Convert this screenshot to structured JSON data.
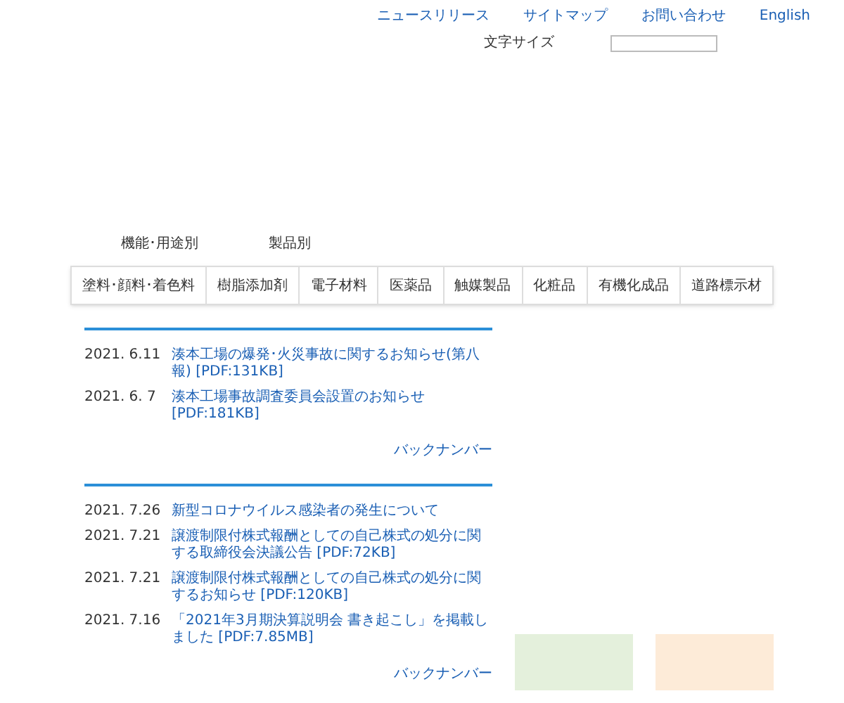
{
  "header_links": [
    "ニュースリリース",
    "サイトマップ",
    "お問い合わせ",
    "English"
  ],
  "font_size": {
    "label": "文字サイズ"
  },
  "tabs": [
    "機能･用途別",
    "製品別"
  ],
  "categories": [
    "塗料･顔料･着色料",
    "樹脂添加剤",
    "電子材料",
    "医薬品",
    "触媒製品",
    "化粧品",
    "有機化成品",
    "道路標示材"
  ],
  "news_sections": [
    {
      "items": [
        {
          "date": "2021. 6.11",
          "title": "湊本工場の爆発･火災事故に関するお知らせ(第八報) [PDF:131KB]"
        },
        {
          "date": "2021. 6. 7",
          "title": "湊本工場事故調査委員会設置のお知らせ[PDF:181KB]"
        }
      ],
      "back_number": "バックナンバー"
    },
    {
      "items": [
        {
          "date": "2021. 7.26",
          "title": "新型コロナウイルス感染者の発生について"
        },
        {
          "date": "2021. 7.21",
          "title": "譲渡制限付株式報酬としての自己株式の処分に関する取締役会決議公告 [PDF:72KB]"
        },
        {
          "date": "2021. 7.21",
          "title": "譲渡制限付株式報酬としての自己株式の処分に関するお知らせ [PDF:120KB]"
        },
        {
          "date": "2021. 7.16",
          "title": "「2021年3月期決算説明会 書き起こし」を掲載しました [PDF:7.85MB]"
        }
      ],
      "back_number": "バックナンバー"
    }
  ],
  "banners": [
    {
      "color": "#e4f0dc"
    },
    {
      "color": "#fdebd8"
    }
  ]
}
